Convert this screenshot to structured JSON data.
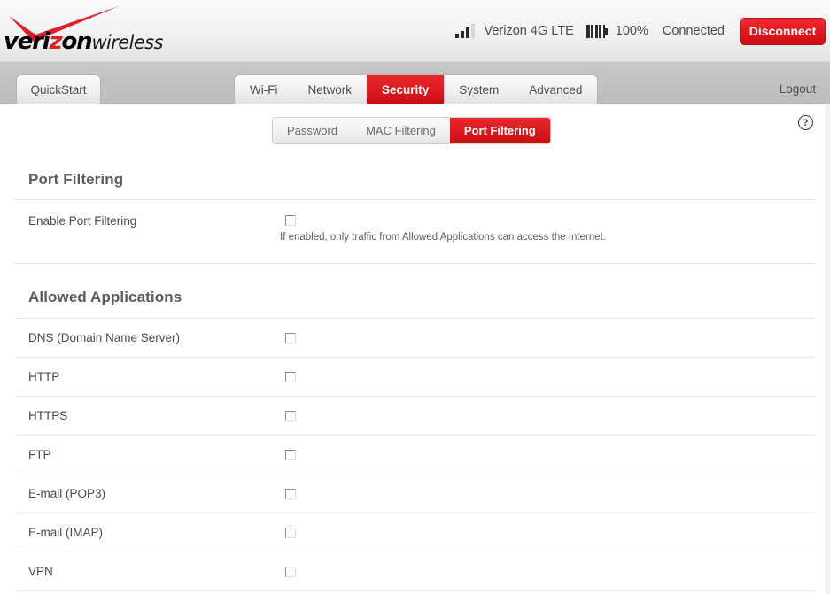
{
  "header": {
    "logo_text_pre": "veri",
    "logo_text_z": "z",
    "logo_text_post": "on",
    "logo_text_wireless": "wireless",
    "signal_icon": "signal-bars-icon",
    "network_label": "Verizon 4G LTE",
    "battery_icon": "battery-icon",
    "battery_percent": "100%",
    "connection_state": "Connected",
    "disconnect_label": "Disconnect",
    "accent_color": "#dc1a20"
  },
  "nav": {
    "quickstart_label": "QuickStart",
    "tabs": [
      {
        "label": "Wi-Fi",
        "active": false
      },
      {
        "label": "Network",
        "active": false
      },
      {
        "label": "Security",
        "active": true
      },
      {
        "label": "System",
        "active": false
      },
      {
        "label": "Advanced",
        "active": false
      }
    ],
    "logout_label": "Logout"
  },
  "subnav": {
    "tabs": [
      {
        "label": "Password",
        "active": false
      },
      {
        "label": "MAC Filtering",
        "active": false
      },
      {
        "label": "Port Filtering",
        "active": true
      }
    ],
    "help_icon": "help-circle-icon",
    "help_glyph": "?"
  },
  "port_filtering": {
    "section_title": "Port Filtering",
    "enable_label": "Enable Port Filtering",
    "enable_checked": false,
    "hint": "If enabled, only traffic from Allowed Applications can access the Internet."
  },
  "allowed_applications": {
    "section_title": "Allowed Applications",
    "rows": [
      {
        "label": "DNS (Domain Name Server)",
        "checked": false
      },
      {
        "label": "HTTP",
        "checked": false
      },
      {
        "label": "HTTPS",
        "checked": false
      },
      {
        "label": "FTP",
        "checked": false
      },
      {
        "label": "E-mail (POP3)",
        "checked": false
      },
      {
        "label": "E-mail (IMAP)",
        "checked": false
      },
      {
        "label": "VPN",
        "checked": false
      }
    ]
  }
}
